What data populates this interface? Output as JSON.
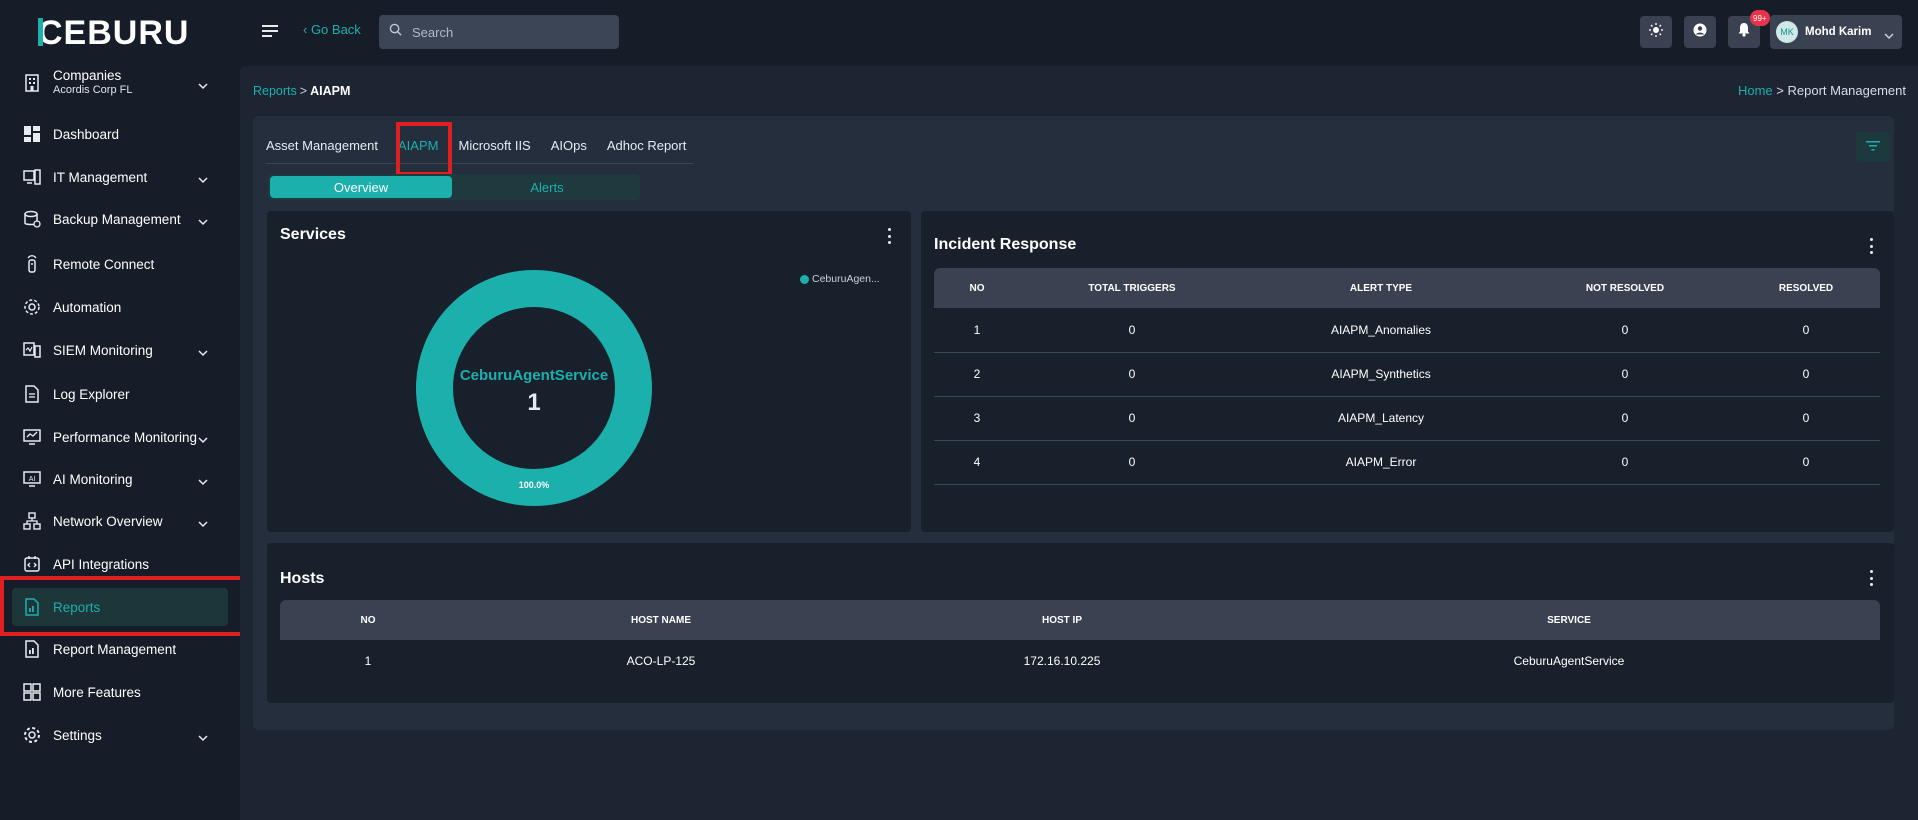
{
  "brand": {
    "logo_text": "CEBURU",
    "accent": "#1bb0ac"
  },
  "header": {
    "go_back": "‹ Go Back",
    "search_placeholder": "Search",
    "notifications_badge": "99+",
    "user": {
      "initials": "MK",
      "name": "Mohd Karim"
    }
  },
  "sidebar": {
    "items": [
      {
        "label": "Companies",
        "sublabel": "Acordis Corp FL",
        "icon": "building-icon",
        "expandable": true
      },
      {
        "label": "Dashboard",
        "icon": "dashboard-icon",
        "expandable": false
      },
      {
        "label": "IT Management",
        "icon": "it-management-icon",
        "expandable": true
      },
      {
        "label": "Backup Management",
        "icon": "backup-icon",
        "expandable": true
      },
      {
        "label": "Remote Connect",
        "icon": "remote-icon",
        "expandable": false
      },
      {
        "label": "Automation",
        "icon": "automation-gear-icon",
        "expandable": false
      },
      {
        "label": "SIEM Monitoring",
        "icon": "siem-icon",
        "expandable": true
      },
      {
        "label": "Log Explorer",
        "icon": "log-file-icon",
        "expandable": false
      },
      {
        "label": "Performance Monitoring",
        "icon": "performance-monitor-icon",
        "expandable": true
      },
      {
        "label": "AI Monitoring",
        "icon": "ai-monitor-icon",
        "expandable": true
      },
      {
        "label": "Network Overview",
        "icon": "network-icon",
        "expandable": true
      },
      {
        "label": "API Integrations",
        "icon": "api-icon",
        "expandable": false
      },
      {
        "label": "Reports",
        "icon": "report-icon",
        "expandable": false,
        "active": true
      },
      {
        "label": "Report Management",
        "icon": "report-management-icon",
        "expandable": false
      },
      {
        "label": "More Features",
        "icon": "grid-icon",
        "expandable": false
      },
      {
        "label": "Settings",
        "icon": "settings-gear-icon",
        "expandable": true
      }
    ]
  },
  "breadcrumb": {
    "parent": "Reports",
    "separator": ">",
    "current": "AIAPM"
  },
  "breadcrumb_right": {
    "home": "Home",
    "separator": ">",
    "current": "Report Management"
  },
  "tabs": [
    {
      "label": "Asset Management"
    },
    {
      "label": "AIAPM",
      "active": true
    },
    {
      "label": "Microsoft IIS"
    },
    {
      "label": "AIOps"
    },
    {
      "label": "Adhoc Report"
    }
  ],
  "segment": {
    "overview": "Overview",
    "alerts": "Alerts"
  },
  "services": {
    "title": "Services",
    "legend_label": "CeburuAgen...",
    "center_label": "CeburuAgentService",
    "center_value": "1",
    "percent_label": "100.0%"
  },
  "chart_data": {
    "type": "pie",
    "title": "Services",
    "categories": [
      "CeburuAgentService"
    ],
    "values": [
      1
    ],
    "percentages": [
      100.0
    ],
    "colors": [
      "#1bb0ac"
    ],
    "legend_position": "top-right"
  },
  "incident": {
    "title": "Incident Response",
    "columns": [
      "NO",
      "TOTAL TRIGGERS",
      "ALERT TYPE",
      "NOT RESOLVED",
      "RESOLVED"
    ],
    "rows": [
      [
        "1",
        "0",
        "AIAPM_Anomalies",
        "0",
        "0"
      ],
      [
        "2",
        "0",
        "AIAPM_Synthetics",
        "0",
        "0"
      ],
      [
        "3",
        "0",
        "AIAPM_Latency",
        "0",
        "0"
      ],
      [
        "4",
        "0",
        "AIAPM_Error",
        "0",
        "0"
      ]
    ]
  },
  "hosts": {
    "title": "Hosts",
    "columns": [
      "NO",
      "HOST NAME",
      "HOST IP",
      "SERVICE"
    ],
    "rows": [
      [
        "1",
        "ACO-LP-125",
        "172.16.10.225",
        "CeburuAgentService"
      ]
    ]
  }
}
